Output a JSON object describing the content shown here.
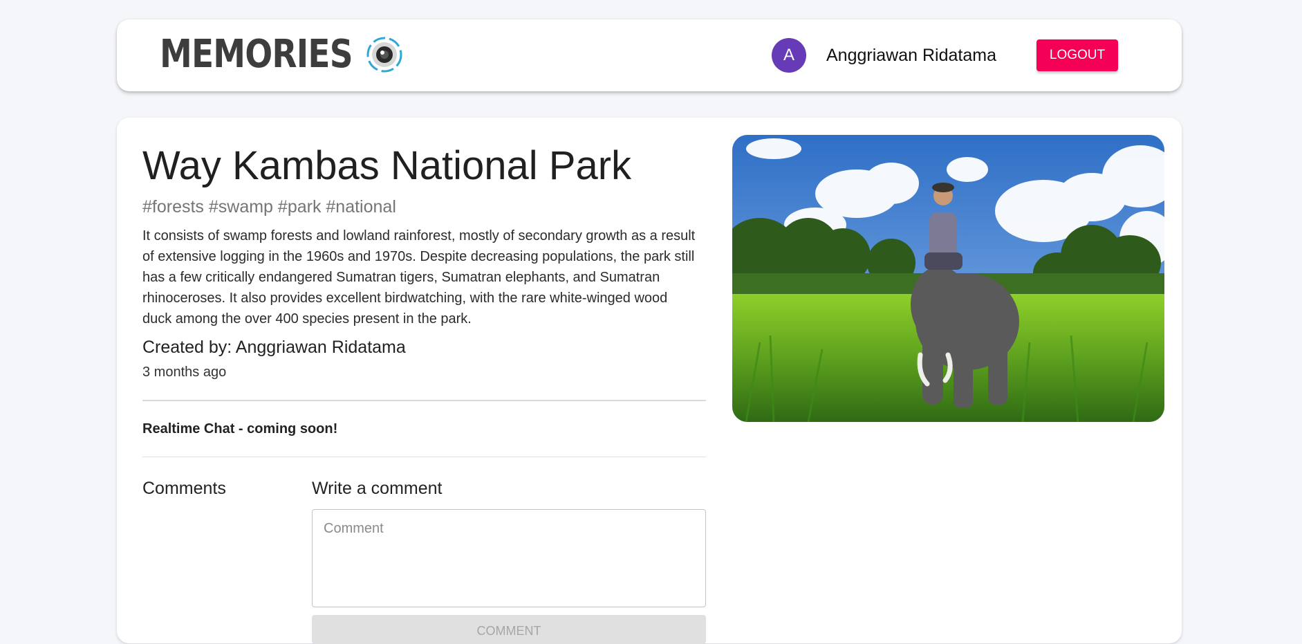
{
  "header": {
    "brand": "MEMORIES",
    "brand_logo_icon": "camera-lens-icon",
    "user": {
      "avatar_initial": "A",
      "avatar_color": "#673ab7",
      "name": "Anggriawan Ridatama"
    },
    "logout_label": "LOGOUT",
    "logout_color": "#f50057"
  },
  "post": {
    "title": "Way Kambas National Park",
    "tags": "#forests #swamp #park #national",
    "message": "It consists of swamp forests and lowland rainforest, mostly of secondary growth as a result of extensive logging in the 1960s and 1970s. Despite decreasing populations, the park still has a few critically endangered Sumatran tigers, Sumatran elephants, and Sumatran rhinoceroses. It also provides excellent birdwatching, with the rare white-winged wood duck among the over 400 species present in the park.",
    "created_by": "Created by: Anggriawan Ridatama",
    "created_time": "3 months ago",
    "chat_label": "Realtime Chat - coming soon!",
    "image": "man riding elephant in grassland"
  },
  "comments": {
    "heading": "Comments",
    "write_heading": "Write a comment",
    "input_placeholder": "Comment",
    "submit_label": "COMMENT"
  }
}
